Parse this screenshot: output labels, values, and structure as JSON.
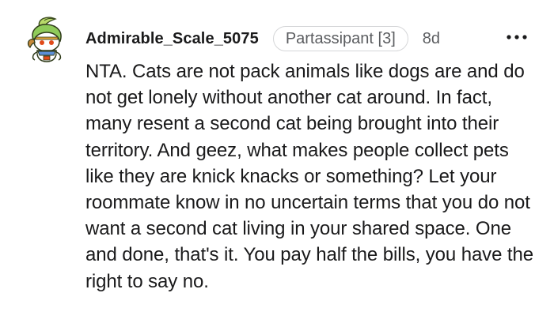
{
  "comment": {
    "author": "Admirable_Scale_5075",
    "flair": "Partassipant [3]",
    "age": "8d",
    "more_icon": "ellipsis-icon",
    "body": "NTA. Cats are not pack animals like dogs are and do not get lonely without another cat around. In fact, many resent a second cat being brought into their territory. And geez, what makes people collect pets like they are knick knacks or something? Let your roommate know in no uncertain terms that you do not want a second cat living in your shared space. One and done, that's it. You pay half the bills, you have the right to say no."
  }
}
